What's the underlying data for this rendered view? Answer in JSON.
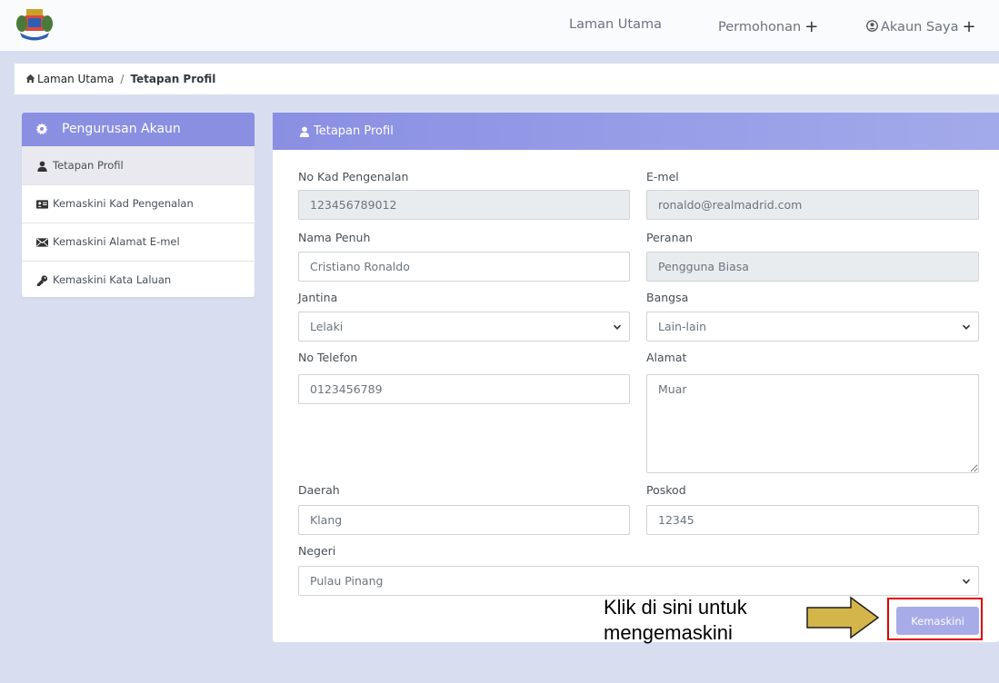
{
  "nav": {
    "home": "Laman Utama",
    "applications": "Permohonan",
    "account": "Akaun Saya",
    "plus": "+"
  },
  "breadcrumb": {
    "home": "Laman Utama",
    "separator": "/",
    "current": "Tetapan Profil"
  },
  "sidebar": {
    "title": "Pengurusan Akaun",
    "items": [
      {
        "label": "Tetapan Profil",
        "icon": "user-icon",
        "active": true
      },
      {
        "label": "Kemaskini Kad Pengenalan",
        "icon": "id-card-icon"
      },
      {
        "label": "Kemaskini Alamat E-mel",
        "icon": "envelope-icon"
      },
      {
        "label": "Kemaskini Kata Laluan",
        "icon": "key-icon"
      }
    ]
  },
  "form": {
    "title": "Tetapan Profil",
    "ic_label": "No Kad Pengenalan",
    "ic_value": "123456789012",
    "email_label": "E-mel",
    "email_value": "ronaldo@realmadrid.com",
    "name_label": "Nama Penuh",
    "name_value": "Cristiano Ronaldo",
    "role_label": "Peranan",
    "role_value": "Pengguna Biasa",
    "gender_label": "Jantina",
    "gender_value": "Lelaki",
    "race_label": "Bangsa",
    "race_value": "Lain-lain",
    "phone_label": "No Telefon",
    "phone_value": "0123456789",
    "address_label": "Alamat",
    "address_value": "Muar",
    "district_label": "Daerah",
    "district_value": "Klang",
    "postcode_label": "Poskod",
    "postcode_value": "12345",
    "state_label": "Negeri",
    "state_value": "Pulau Pinang",
    "submit_label": "Kemaskini"
  },
  "annotation": {
    "line1": "Klik di sini untuk",
    "line2": "mengemaskini"
  },
  "colors": {
    "accent": "#8a8fe2",
    "button": "#a7ace9",
    "highlight": "#e00000",
    "arrow_fill": "#d4b54a"
  }
}
